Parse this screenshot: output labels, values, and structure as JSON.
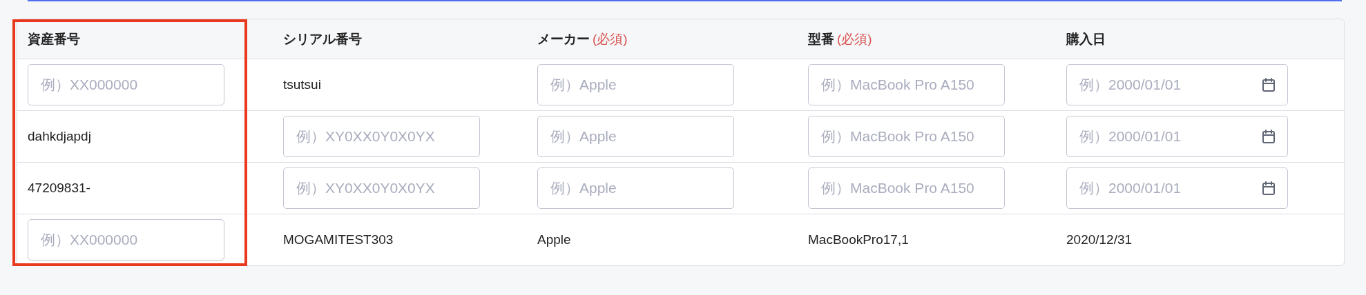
{
  "columns": [
    {
      "label": "資産番号",
      "highlighted": true
    },
    {
      "label": "シリアル番号",
      "highlighted": false
    },
    {
      "label": "メーカー",
      "required_note": "(必須)",
      "highlighted": false
    },
    {
      "label": "型番",
      "required_note": "(必須)",
      "highlighted": false
    },
    {
      "label": "購入日",
      "highlighted": false
    }
  ],
  "rows": [
    [
      {
        "kind": "input",
        "placeholder": "例）XX000000"
      },
      {
        "kind": "text",
        "value": "tsutsui"
      },
      {
        "kind": "input",
        "placeholder": "例）Apple"
      },
      {
        "kind": "input",
        "placeholder": "例）MacBook Pro A150"
      },
      {
        "kind": "date",
        "placeholder": "例）2000/01/01"
      }
    ],
    [
      {
        "kind": "text",
        "value": "dahkdjapdj"
      },
      {
        "kind": "input",
        "placeholder": "例）XY0XX0Y0X0YX"
      },
      {
        "kind": "input",
        "placeholder": "例）Apple"
      },
      {
        "kind": "input",
        "placeholder": "例）MacBook Pro A150"
      },
      {
        "kind": "date",
        "placeholder": "例）2000/01/01"
      }
    ],
    [
      {
        "kind": "text",
        "value": "47209831-"
      },
      {
        "kind": "input",
        "placeholder": "例）XY0XX0Y0X0YX"
      },
      {
        "kind": "input",
        "placeholder": "例）Apple"
      },
      {
        "kind": "input",
        "placeholder": "例）MacBook Pro A150"
      },
      {
        "kind": "date",
        "placeholder": "例）2000/01/01"
      }
    ],
    [
      {
        "kind": "input",
        "placeholder": "例）XX000000"
      },
      {
        "kind": "text",
        "value": "MOGAMITEST303"
      },
      {
        "kind": "text",
        "value": "Apple"
      },
      {
        "kind": "text",
        "value": "MacBookPro17,1"
      },
      {
        "kind": "text",
        "value": "2020/12/31"
      }
    ]
  ]
}
